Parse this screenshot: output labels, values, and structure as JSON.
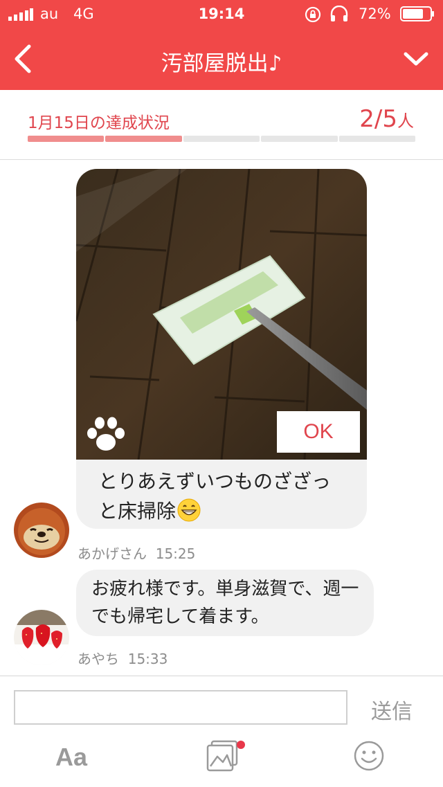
{
  "status": {
    "carrier": "au",
    "network": "4G",
    "time": "19:14",
    "battery": "72%"
  },
  "nav": {
    "title": "汚部屋脱出♪"
  },
  "progress": {
    "label": "1月15日の達成状況",
    "count": "2/5",
    "unit": "人",
    "completed": 2,
    "total": 5
  },
  "post": {
    "ok_label": "OK",
    "text": "とりあえずいつものざざっと床掃除",
    "emoji": "grinning-face-icon",
    "author": "あかげさん",
    "time": "15:25"
  },
  "reply": {
    "text": "お疲れ様です。単身滋賀で、週一でも帰宅して着ます。",
    "author": "あやち",
    "time": "15:33"
  },
  "composer": {
    "input_value": "",
    "send_label": "送信",
    "font_label": "Aa"
  },
  "colors": {
    "brand": "#f14848",
    "accent_text": "#e0454d",
    "progress_done": "#f08d8d"
  }
}
